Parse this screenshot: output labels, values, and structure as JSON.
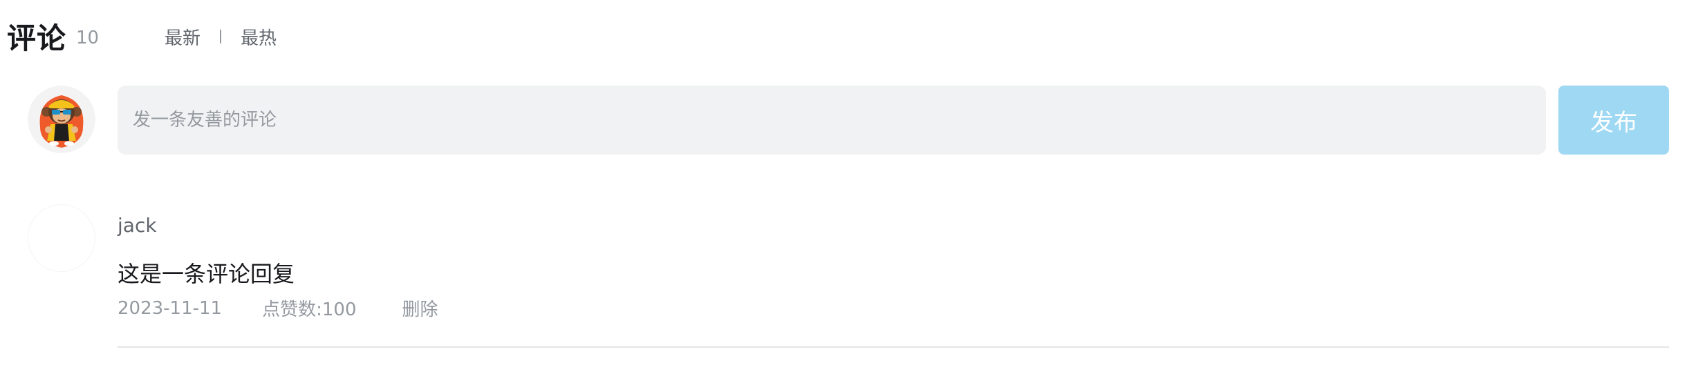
{
  "header": {
    "title": "评论",
    "count": "10"
  },
  "sort": {
    "newest_label": "最新",
    "hottest_label": "最热"
  },
  "composer": {
    "placeholder": "发一条友善的评论",
    "value": "",
    "publish_label": "发布"
  },
  "comments": [
    {
      "username": "jack",
      "content": "这是一条评论回复",
      "date": "2023-11-11",
      "likes_label": "点赞数:100",
      "delete_label": "删除"
    }
  ],
  "colors": {
    "publish_button": "#9ed8f2",
    "input_background": "#f1f2f3",
    "muted_text": "#9499a0",
    "divider": "#e3e5e7"
  }
}
